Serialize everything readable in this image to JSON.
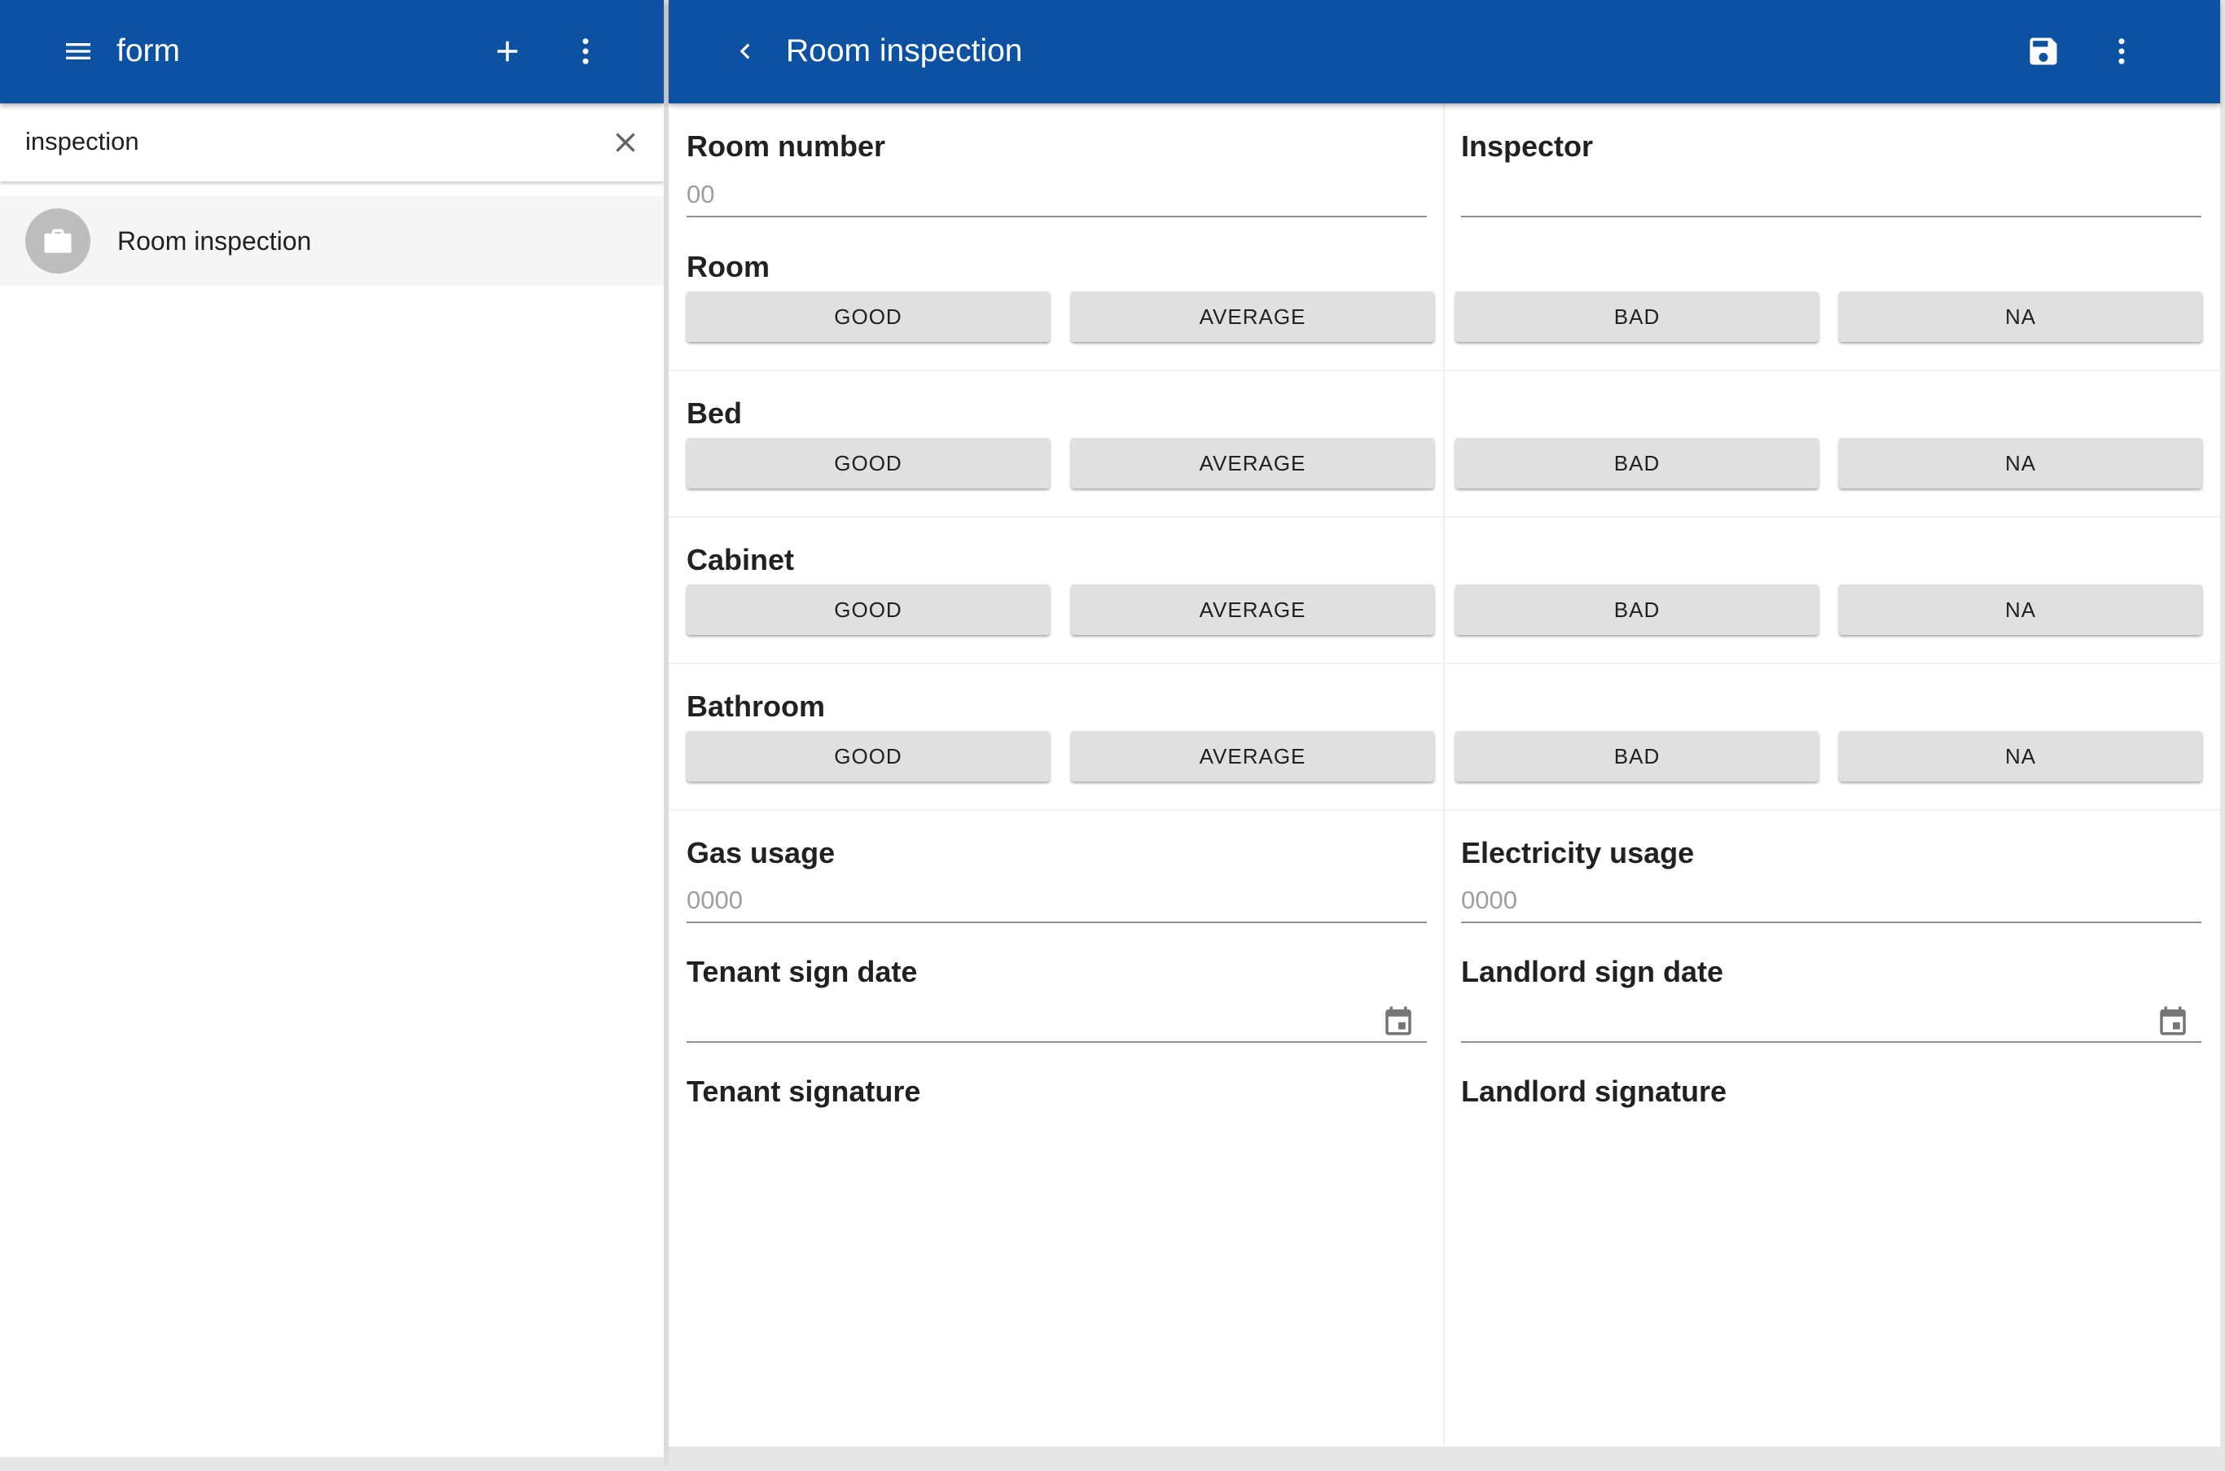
{
  "colors": {
    "app_bar": "#0d51a3",
    "button": "#e0e0e0",
    "selected_row": "#f5f5f5"
  },
  "sidebar": {
    "title": "form",
    "search": {
      "value": "inspection"
    },
    "items": [
      {
        "label": "Room inspection",
        "icon": "briefcase-icon"
      }
    ]
  },
  "form": {
    "title": "Room inspection",
    "fields": {
      "room_number": {
        "label": "Room number",
        "placeholder": "00"
      },
      "inspector": {
        "label": "Inspector",
        "placeholder": ""
      },
      "gas_usage": {
        "label": "Gas usage",
        "placeholder": "0000"
      },
      "electricity_usage": {
        "label": "Electricity usage",
        "placeholder": "0000"
      },
      "tenant_sign_date": {
        "label": "Tenant sign date"
      },
      "landlord_sign_date": {
        "label": "Landlord sign date"
      },
      "tenant_signature": {
        "label": "Tenant signature"
      },
      "landlord_signature": {
        "label": "Landlord signature"
      }
    },
    "ratings": [
      {
        "label": "Room",
        "options": [
          "GOOD",
          "AVERAGE",
          "BAD",
          "NA"
        ]
      },
      {
        "label": "Bed",
        "options": [
          "GOOD",
          "AVERAGE",
          "BAD",
          "NA"
        ]
      },
      {
        "label": "Cabinet",
        "options": [
          "GOOD",
          "AVERAGE",
          "BAD",
          "NA"
        ]
      },
      {
        "label": "Bathroom",
        "options": [
          "GOOD",
          "AVERAGE",
          "BAD",
          "NA"
        ]
      }
    ]
  }
}
